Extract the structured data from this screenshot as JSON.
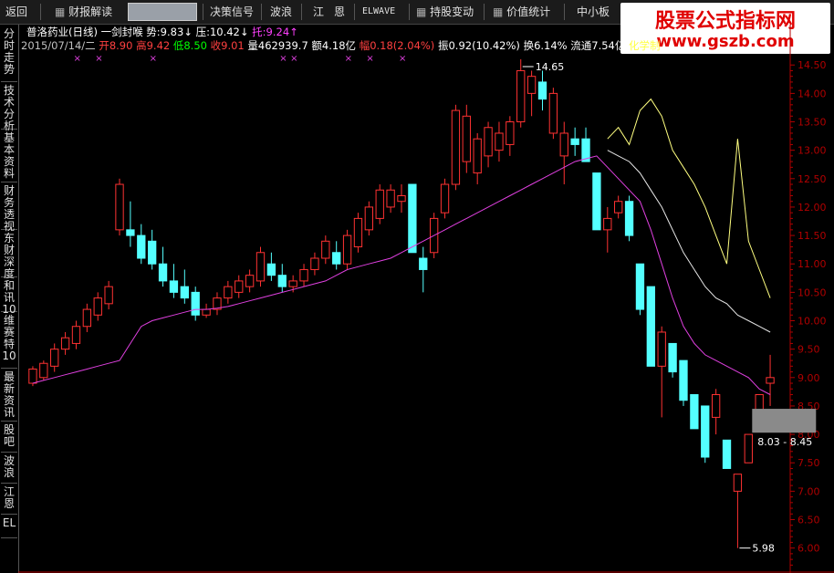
{
  "toolbar": {
    "back": "返回",
    "report": "财报解读",
    "decision": "决策信号",
    "wave": "波浪",
    "jiang": "江",
    "en": "恩",
    "elwave": "ELWAVE",
    "holding": "持股变动",
    "value": "价值统计",
    "smallcap": "中小板"
  },
  "watermark": {
    "line1": "股票公式指标网",
    "line2": "www.gszb.com"
  },
  "sidetabs": [
    "分时走势",
    "技术分析",
    "基本资料",
    "财务透视",
    "东财深度",
    "和讯10",
    "维赛特10",
    "最新资讯",
    "股吧",
    "波浪",
    "江恩",
    "EL"
  ],
  "header": {
    "title": "普洛药业(日线)",
    "indicator": "一剑封喉",
    "shi_label": "势:",
    "shi_value": "9.83↓",
    "ya_label": "压:",
    "ya_value": "10.42↓",
    "tuo_label": "托:",
    "tuo_value": "9.24↑",
    "date": "2015/07/14/二",
    "open_label": "开",
    "open": "8.90",
    "high_label": "高",
    "high": "9.42",
    "low_label": "低",
    "low": "8.50",
    "close_label": "收",
    "close": "9.01",
    "vol_label": "量",
    "vol": "462939.7",
    "amount_label": "额",
    "amount": "4.18亿",
    "change_label": "幅",
    "change": "0.18(2.04%)",
    "amp_label": "振",
    "amp": "0.92(10.42%)",
    "turnover_label": "换",
    "turnover": "6.14%",
    "float_label": "流通",
    "float": "7.54亿",
    "industry": "化学制"
  },
  "annotations": {
    "high_marker": "14.65",
    "low_marker": "5.98",
    "range_box": "8.03 - 8.45"
  },
  "colors": {
    "up": "#ff3232",
    "down": "#54ffff",
    "ma_purple": "#e040e0",
    "ma_yellow": "#ffff80",
    "ma_white": "#e6e6e6",
    "axis": "#b00000"
  },
  "chart_data": {
    "type": "candlestick",
    "ylim": [
      5.85,
      14.6
    ],
    "yticks": [
      "14.50",
      "14.00",
      "13.50",
      "13.00",
      "12.50",
      "12.00",
      "11.50",
      "11.00",
      "10.50",
      "10.00",
      "9.50",
      "9.00",
      "8.50",
      "8.00",
      "7.50",
      "7.00",
      "6.50",
      "6.00"
    ],
    "candles": [
      [
        8.9,
        9.2,
        8.85,
        9.15
      ],
      [
        9.0,
        9.3,
        8.95,
        9.25
      ],
      [
        9.2,
        9.6,
        9.1,
        9.5
      ],
      [
        9.5,
        9.8,
        9.4,
        9.7
      ],
      [
        9.6,
        10.0,
        9.5,
        9.9
      ],
      [
        9.9,
        10.3,
        9.8,
        10.2
      ],
      [
        10.1,
        10.5,
        10.0,
        10.4
      ],
      [
        10.3,
        10.7,
        10.2,
        10.6
      ],
      [
        11.6,
        12.5,
        11.5,
        12.4
      ],
      [
        11.6,
        12.1,
        11.3,
        11.5
      ],
      [
        11.5,
        11.7,
        11.0,
        11.1
      ],
      [
        11.4,
        11.6,
        10.9,
        11.0
      ],
      [
        11.0,
        11.3,
        10.6,
        10.7
      ],
      [
        10.7,
        11.0,
        10.4,
        10.5
      ],
      [
        10.6,
        10.9,
        10.3,
        10.4
      ],
      [
        10.5,
        10.6,
        10.0,
        10.1
      ],
      [
        10.1,
        10.3,
        10.05,
        10.2
      ],
      [
        10.2,
        10.5,
        10.1,
        10.4
      ],
      [
        10.4,
        10.7,
        10.3,
        10.6
      ],
      [
        10.5,
        10.8,
        10.4,
        10.7
      ],
      [
        10.6,
        10.9,
        10.5,
        10.8
      ],
      [
        10.7,
        11.3,
        10.6,
        11.2
      ],
      [
        11.0,
        11.2,
        10.7,
        10.8
      ],
      [
        10.8,
        11.0,
        10.5,
        10.6
      ],
      [
        10.6,
        10.8,
        10.5,
        10.7
      ],
      [
        10.7,
        11.0,
        10.6,
        10.9
      ],
      [
        10.9,
        11.2,
        10.8,
        11.1
      ],
      [
        11.1,
        11.5,
        11.0,
        11.4
      ],
      [
        11.2,
        11.4,
        10.9,
        11.0
      ],
      [
        11.0,
        11.6,
        10.9,
        11.5
      ],
      [
        11.3,
        11.9,
        11.2,
        11.8
      ],
      [
        11.6,
        12.1,
        11.5,
        12.0
      ],
      [
        11.8,
        12.4,
        11.7,
        12.3
      ],
      [
        12.0,
        12.4,
        11.9,
        12.3
      ],
      [
        12.1,
        12.4,
        11.9,
        12.2
      ],
      [
        12.4,
        12.4,
        11.2,
        11.2
      ],
      [
        11.1,
        11.3,
        10.5,
        10.9
      ],
      [
        11.2,
        11.9,
        11.1,
        11.8
      ],
      [
        11.9,
        12.5,
        11.8,
        12.4
      ],
      [
        12.4,
        13.8,
        12.3,
        13.7
      ],
      [
        12.8,
        13.8,
        12.6,
        13.6
      ],
      [
        12.6,
        13.3,
        12.4,
        13.2
      ],
      [
        12.9,
        13.5,
        12.7,
        13.4
      ],
      [
        13.0,
        13.5,
        12.8,
        13.3
      ],
      [
        13.1,
        13.6,
        12.9,
        13.5
      ],
      [
        13.5,
        14.6,
        13.4,
        14.4
      ],
      [
        14.0,
        14.4,
        13.6,
        14.3
      ],
      [
        14.2,
        14.4,
        13.7,
        13.9
      ],
      [
        13.3,
        14.1,
        13.2,
        14.0
      ],
      [
        12.9,
        13.5,
        12.4,
        13.3
      ],
      [
        13.2,
        13.4,
        12.9,
        13.1
      ],
      [
        13.2,
        13.4,
        12.8,
        12.8
      ],
      [
        12.6,
        12.6,
        11.6,
        11.6
      ],
      [
        11.6,
        12.0,
        11.2,
        11.8
      ],
      [
        11.9,
        12.2,
        11.8,
        12.1
      ],
      [
        12.1,
        12.2,
        11.4,
        11.5
      ],
      [
        11.0,
        11.0,
        10.1,
        10.2
      ],
      [
        10.6,
        10.6,
        9.2,
        9.2
      ],
      [
        9.2,
        9.9,
        8.3,
        9.8
      ],
      [
        9.6,
        9.6,
        9.0,
        9.1
      ],
      [
        9.3,
        9.3,
        8.5,
        8.6
      ],
      [
        8.7,
        8.7,
        8.1,
        8.1
      ],
      [
        8.5,
        8.5,
        7.5,
        7.6
      ],
      [
        8.3,
        8.8,
        8.0,
        8.7
      ],
      [
        7.9,
        7.9,
        7.4,
        7.4
      ],
      [
        7.0,
        7.3,
        6.0,
        7.3
      ],
      [
        7.5,
        8.0,
        7.5,
        8.0
      ],
      [
        8.3,
        8.7,
        8.3,
        8.7
      ],
      [
        8.9,
        9.4,
        8.5,
        9.0
      ]
    ],
    "ma_purple": [
      8.9,
      8.95,
      9.0,
      9.05,
      9.1,
      9.15,
      9.2,
      9.25,
      9.3,
      9.6,
      9.9,
      10.0,
      10.05,
      10.1,
      10.15,
      10.2,
      10.2,
      10.22,
      10.25,
      10.3,
      10.35,
      10.4,
      10.45,
      10.5,
      10.55,
      10.6,
      10.65,
      10.7,
      10.8,
      10.9,
      10.95,
      11.0,
      11.05,
      11.1,
      11.2,
      11.3,
      11.4,
      11.5,
      11.6,
      11.7,
      11.8,
      11.9,
      12.0,
      12.1,
      12.2,
      12.3,
      12.4,
      12.5,
      12.6,
      12.7,
      12.8,
      12.85,
      12.9,
      12.7,
      12.5,
      12.3,
      12.1,
      11.6,
      11.0,
      10.4,
      9.9,
      9.6,
      9.4,
      9.3,
      9.2,
      9.1,
      9.0,
      8.8,
      8.7
    ],
    "ma_yellow": [
      null,
      null,
      null,
      null,
      null,
      null,
      null,
      null,
      null,
      null,
      null,
      null,
      null,
      null,
      null,
      null,
      null,
      null,
      null,
      null,
      null,
      null,
      null,
      null,
      null,
      null,
      null,
      null,
      null,
      null,
      null,
      null,
      null,
      null,
      null,
      null,
      null,
      null,
      null,
      null,
      null,
      null,
      null,
      null,
      null,
      null,
      null,
      null,
      null,
      null,
      null,
      null,
      null,
      13.2,
      13.4,
      13.1,
      13.7,
      13.9,
      13.6,
      13.0,
      12.7,
      12.4,
      12.0,
      11.5,
      11.0,
      13.2,
      11.4,
      10.9,
      10.4
    ],
    "ma_white": [
      null,
      null,
      null,
      null,
      null,
      null,
      null,
      null,
      null,
      null,
      null,
      null,
      null,
      null,
      null,
      null,
      null,
      null,
      null,
      null,
      null,
      null,
      null,
      null,
      null,
      null,
      null,
      null,
      null,
      null,
      null,
      null,
      null,
      null,
      null,
      null,
      null,
      null,
      null,
      null,
      null,
      null,
      null,
      null,
      null,
      null,
      null,
      null,
      null,
      null,
      null,
      null,
      null,
      13.0,
      12.9,
      12.8,
      12.6,
      12.3,
      12.0,
      11.6,
      11.2,
      10.9,
      10.6,
      10.4,
      10.3,
      10.1,
      10.0,
      9.9,
      9.8
    ],
    "signal_markers": [
      4,
      6,
      11,
      23,
      24,
      29,
      31,
      34
    ]
  }
}
